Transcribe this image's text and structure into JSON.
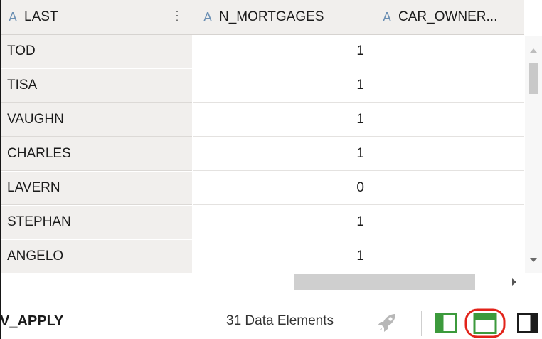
{
  "header": {
    "columns": [
      {
        "type": "A",
        "name": "LAST"
      },
      {
        "type": "A",
        "name": "N_MORTGAGES"
      },
      {
        "type": "A",
        "name": "CAR_OWNER..."
      }
    ],
    "menu_glyph": "⋮"
  },
  "rows": [
    {
      "last": "TOD",
      "n_mortgages": "1"
    },
    {
      "last": "TISA",
      "n_mortgages": "1"
    },
    {
      "last": "VAUGHN",
      "n_mortgages": "1"
    },
    {
      "last": "CHARLES",
      "n_mortgages": "1"
    },
    {
      "last": "LAVERN",
      "n_mortgages": "0"
    },
    {
      "last": "STEPHAN",
      "n_mortgages": "1"
    },
    {
      "last": "ANGELO",
      "n_mortgages": "1"
    }
  ],
  "footer": {
    "dataset_name": "V_APPLY",
    "element_count": "31 Data Elements"
  },
  "icons": {
    "rocket": "rocket-icon",
    "layout_left": "left-panel-layout-icon",
    "layout_top": "top-panel-layout-icon",
    "layout_right": "right-panel-layout-icon"
  },
  "colors": {
    "header_bg": "#f1efed",
    "type_letter": "#6b8fb3",
    "layout_green": "#3c9a3c",
    "highlight_red": "#e2231a"
  }
}
